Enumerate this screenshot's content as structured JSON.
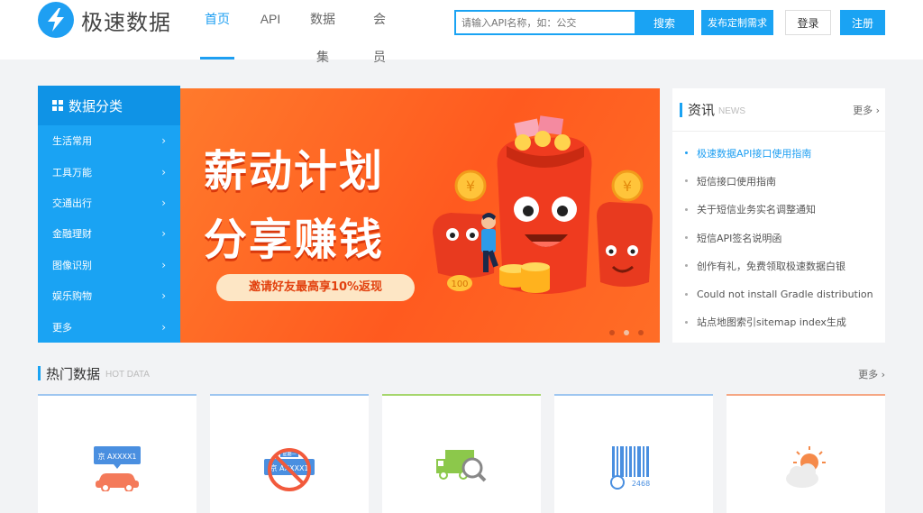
{
  "header": {
    "logo_text": "极速数据",
    "nav": [
      {
        "label": "首页",
        "active": true
      },
      {
        "label": "API",
        "active": false
      },
      {
        "label": "数据集",
        "active": false
      },
      {
        "label": "会员",
        "active": false
      }
    ],
    "search_placeholder": "请输入API名称，如：公交",
    "search_button": "搜索",
    "publish_button": "发布定制需求",
    "login_button": "登录",
    "register_button": "注册"
  },
  "categories": {
    "title": "数据分类",
    "items": [
      "生活常用",
      "工具万能",
      "交通出行",
      "金融理财",
      "图像识别",
      "娱乐购物",
      "更多"
    ]
  },
  "banner": {
    "title_line1": "薪动计划",
    "title_line2": "分享赚钱",
    "pill_text": "邀请好友最高享10%返现",
    "coin_label": "100",
    "slide_count": 3,
    "active_slide": 2
  },
  "news": {
    "title": "资讯",
    "subtitle": "NEWS",
    "more": "更多",
    "items": [
      "极速数据API接口使用指南",
      "短信接口使用指南",
      "关于短信业务实名调整通知",
      "短信API签名说明函",
      "创作有礼，免费领取极速数据白银",
      "Could not install Gradle distribution",
      "站点地图索引sitemap index生成"
    ],
    "active_index": 0
  },
  "hot": {
    "title": "热门数据",
    "subtitle": "HOT DATA",
    "more": "更多",
    "cards": [
      {
        "icon": "license-plate-car-icon",
        "label": "京 AXXXX1"
      },
      {
        "icon": "traffic-restriction-icon",
        "label": "京 AXXXX1",
        "top_label": "星期一"
      },
      {
        "icon": "logistics-truck-icon"
      },
      {
        "icon": "barcode-icon",
        "label": "2468"
      },
      {
        "icon": "weather-icon"
      }
    ],
    "accent_colors": [
      "#9ec6f0",
      "#9ec6f0",
      "#a6d66d",
      "#9ec6f0",
      "#f5a784"
    ]
  }
}
